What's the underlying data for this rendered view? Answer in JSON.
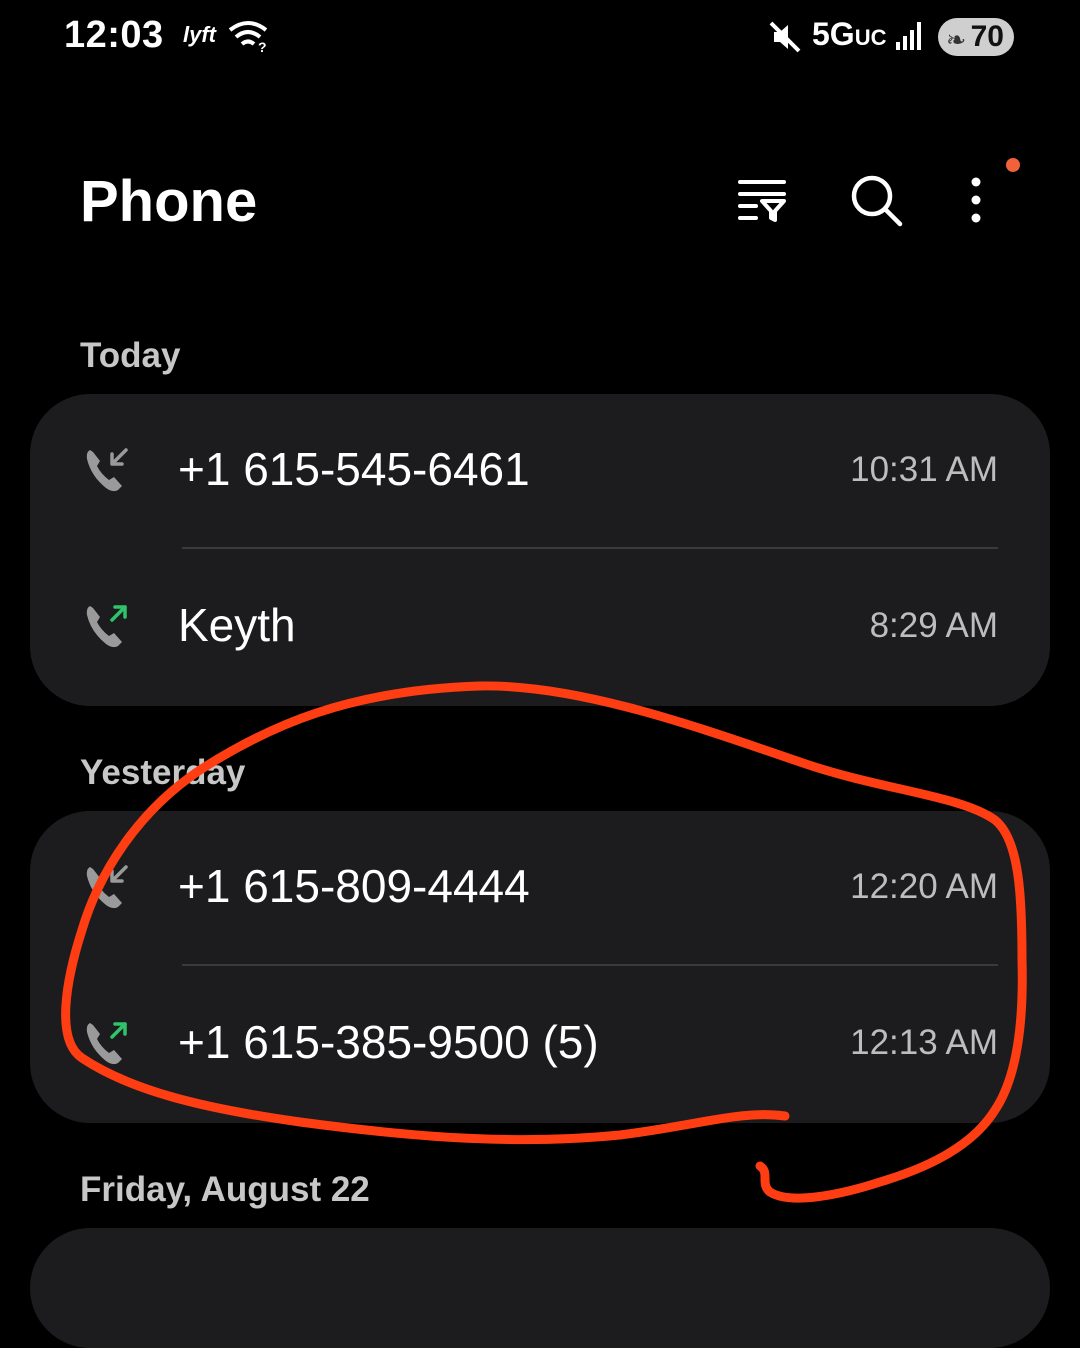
{
  "status_bar": {
    "time": "12:03",
    "lyft_label": "lyft",
    "network_main": "5G",
    "network_sub": "UC",
    "battery": "70"
  },
  "header": {
    "title": "Phone"
  },
  "sections": [
    {
      "label": "Today"
    },
    {
      "label": "Yesterday"
    },
    {
      "label": "Friday, August 22"
    }
  ],
  "calls": [
    {
      "name": "+1 615-545-6461",
      "time": "10:31 AM",
      "type": "incoming"
    },
    {
      "name": "Keyth",
      "time": "8:29 AM",
      "type": "outgoing"
    },
    {
      "name": "+1 615-809-4444",
      "time": "12:20 AM",
      "type": "incoming"
    },
    {
      "name": "+1 615-385-9500 (5)",
      "time": "12:13 AM",
      "type": "outgoing"
    }
  ],
  "colors": {
    "background": "#000000",
    "card": "#1c1c1e",
    "accent_dot": "#f0623a",
    "outgoing_arrow": "#2fc46a",
    "annotation": "#ff3d12"
  }
}
